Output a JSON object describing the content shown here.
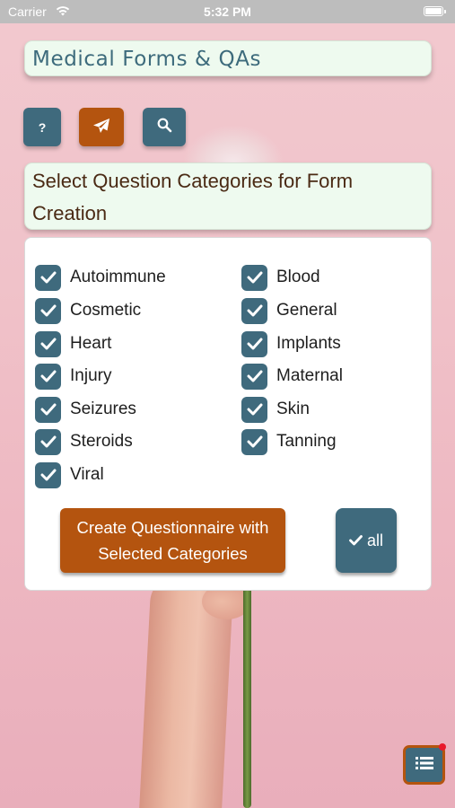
{
  "status_bar": {
    "carrier": "Carrier",
    "time": "5:32 PM"
  },
  "app": {
    "title": "Medical Forms & QAs"
  },
  "toolbar": {
    "help_label": "?",
    "help_icon": "question-mark-icon",
    "send_icon": "paper-plane-icon",
    "search_icon": "magnifier-icon"
  },
  "section": {
    "title": "Select Question Categories for Form Creation"
  },
  "categories": [
    {
      "label": "Autoimmune",
      "checked": true
    },
    {
      "label": "Blood",
      "checked": true
    },
    {
      "label": "Cosmetic",
      "checked": true
    },
    {
      "label": "General",
      "checked": true
    },
    {
      "label": "Heart",
      "checked": true
    },
    {
      "label": "Implants",
      "checked": true
    },
    {
      "label": "Injury",
      "checked": true
    },
    {
      "label": "Maternal",
      "checked": true
    },
    {
      "label": "Seizures",
      "checked": true
    },
    {
      "label": "Skin",
      "checked": true
    },
    {
      "label": "Steroids",
      "checked": true
    },
    {
      "label": "Tanning",
      "checked": true
    },
    {
      "label": "Viral",
      "checked": true
    }
  ],
  "actions": {
    "create_label": "Create Questionnaire with Selected Categories",
    "select_all_label": "all"
  },
  "floating_button": {
    "icon": "list-icon",
    "has_notification": true
  },
  "colors": {
    "primary_teal": "#3f6a7d",
    "accent_orange": "#b4540f",
    "panel_bg": "#eefaef",
    "notification_red": "#e8192c"
  }
}
